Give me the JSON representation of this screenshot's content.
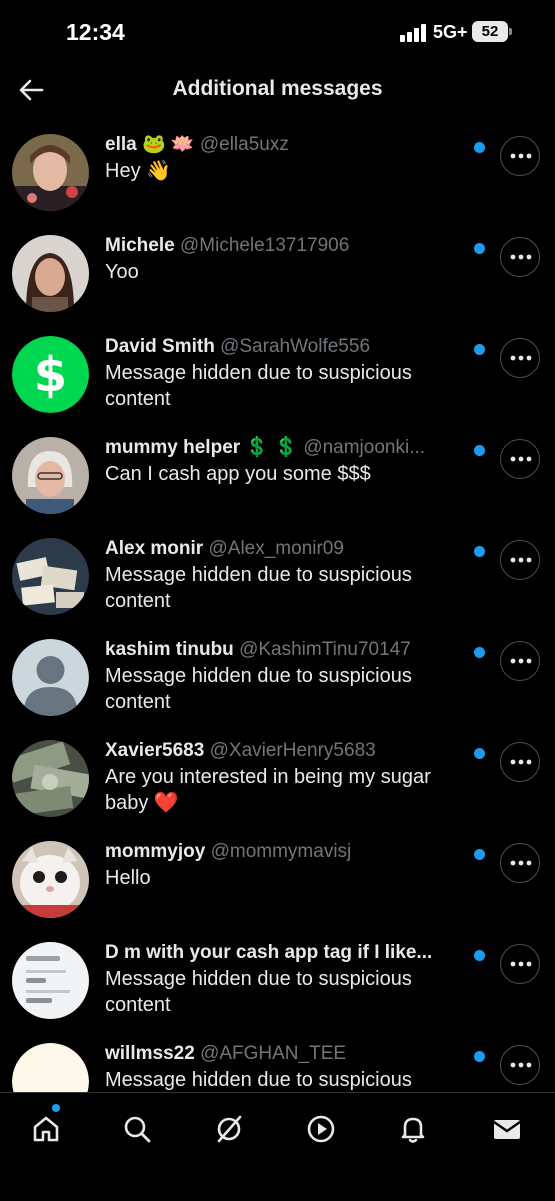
{
  "status_bar": {
    "time": "12:34",
    "network": "5G+",
    "battery": "52"
  },
  "header": {
    "title": "Additional messages"
  },
  "messages": [
    {
      "name": "ella 🐸 🪷",
      "handle": "@ella5uxz",
      "text": "Hey 👋",
      "avatar": "photo-person"
    },
    {
      "name": "Michele",
      "handle": "@Michele13717906",
      "text": "Yoo",
      "avatar": "photo-person"
    },
    {
      "name": "David Smith",
      "handle": "@SarahWolfe556",
      "text": "Message hidden due to suspicious content",
      "avatar": "cash-app-logo"
    },
    {
      "name": "mummy helper 💲 💲",
      "handle": "@namjoonki...",
      "text": "Can I cash app you some  $$$",
      "avatar": "photo-person"
    },
    {
      "name": "Alex monir",
      "handle": "@Alex_monir09",
      "text": "Message hidden due to suspicious content",
      "avatar": "photo-cash"
    },
    {
      "name": "kashim tinubu",
      "handle": "@KashimTinu70147",
      "text": "Message hidden due to suspicious content",
      "avatar": "default-avatar"
    },
    {
      "name": "Xavier5683",
      "handle": "@XavierHenry5683",
      "text": "Are you interested in being my sugar baby ❤️",
      "avatar": "photo-cash"
    },
    {
      "name": "mommyjoy",
      "handle": "@mommymavisj",
      "text": "Hello",
      "avatar": "photo-cat"
    },
    {
      "name": "D m with your cash app tag if I like...",
      "handle": "",
      "text": "Message hidden due to suspicious content",
      "avatar": "photo-screenshot"
    },
    {
      "name": "willmss22",
      "handle": "@AFGHAN_TEE",
      "text": "Message hidden due to suspicious",
      "avatar": "photo-light"
    }
  ],
  "tabs": [
    "home-icon",
    "search-icon",
    "grok-icon",
    "play-icon",
    "notifications-icon",
    "messages-icon"
  ],
  "colors": {
    "accent": "#1d9bf0",
    "muted": "#71767b",
    "cash_green": "#00d64f"
  }
}
